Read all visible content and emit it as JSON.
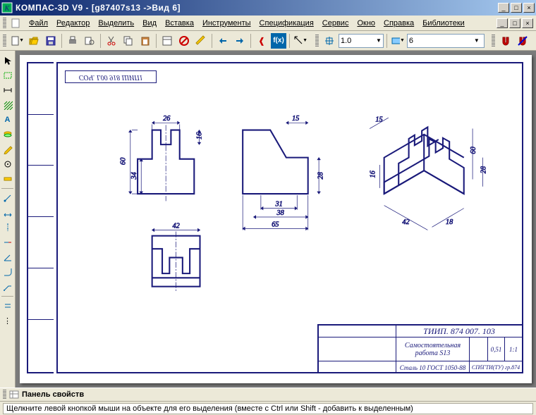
{
  "window": {
    "title": "КОМПАС-3D V9 - [g87407s13 ->Вид 6]",
    "min": "_",
    "max": "□",
    "close": "×"
  },
  "menu": {
    "file": "Файл",
    "edit": "Редактор",
    "select": "Выделить",
    "view": "Вид",
    "insert": "Вставка",
    "tools": "Инструменты",
    "spec": "Спецификация",
    "service": "Сервис",
    "window": "Окно",
    "help": "Справка",
    "libs": "Библиотеки"
  },
  "toolbar": {
    "zoom_value": "1.0",
    "state_value": "6"
  },
  "drawing": {
    "stamp": "СОЧ. L00 918 ШИП1",
    "dims": {
      "d26": "26",
      "d60": "60",
      "d34": "34",
      "d16": "16",
      "d15": "15",
      "d31": "31",
      "d38": "38",
      "d65": "65",
      "d28": "28",
      "d42": "42",
      "iso60": "60",
      "iso28": "28",
      "iso16": "16",
      "iso42": "42",
      "iso15": "15",
      "iso18": "18"
    }
  },
  "titleblock": {
    "code": "ТИИП. 874 007. 103",
    "name1": "Самостоятельная",
    "name2": "работа S13",
    "scale1": "0,51",
    "scale2": "1:1",
    "material": "Сталь 10 ГОСТ 1050-88",
    "org": "СПбГТИ(ТУ) гр.874"
  },
  "panel": {
    "label": "Панель свойств"
  },
  "status": {
    "hint": "Щелкните левой кнопкой мыши на объекте для его выделения (вместе с Ctrl или Shift - добавить к выделенным)"
  },
  "icons": {
    "new": "new",
    "open": "open",
    "save": "save",
    "print": "print",
    "preview": "preview",
    "cut": "cut",
    "copy": "copy",
    "paste": "paste",
    "props": "props",
    "cancel": "cancel",
    "brush": "brush",
    "undo": "undo",
    "redo": "redo",
    "brace": "brace",
    "fx": "f(x)",
    "help": "help",
    "magnet": "magnet",
    "nomagnet": "no-magnet"
  }
}
